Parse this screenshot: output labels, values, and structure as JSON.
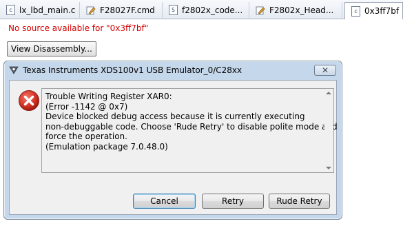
{
  "tabs": [
    {
      "label": "lx_lbd_main.c",
      "icon": "c-file-icon",
      "glyph": "c"
    },
    {
      "label": "F28027F.cmd",
      "icon": "pencil-file-icon"
    },
    {
      "label": "f2802x_code...",
      "icon": "s-file-icon",
      "glyph": "S"
    },
    {
      "label": "F2802x_Head...",
      "icon": "pencil-file-icon"
    },
    {
      "label": "0x3ff7bf",
      "icon": "c-file-icon",
      "glyph": "c",
      "active": true
    }
  ],
  "editor": {
    "no_source": "No source available for \"0x3ff7bf\"",
    "view_disassembly": "View Disassembly..."
  },
  "dialog": {
    "title": "Texas Instruments XDS100v1 USB Emulator_0/C28xx",
    "close_glyph": "✕",
    "message_lines": [
      "Trouble Writing Register XAR0:",
      "(Error -1142 @ 0x7)",
      "Device blocked debug access because it is currently executing",
      "non-debuggable code. Choose 'Rude Retry' to disable polite mode and",
      "force the operation.",
      "(Emulation package 7.0.48.0)"
    ],
    "buttons": {
      "cancel": "Cancel",
      "retry": "Retry",
      "rude_retry": "Rude Retry"
    }
  },
  "colors": {
    "error_red": "#d40000",
    "dialog_frame": "#c5d7ea",
    "error_icon": "#d93a2b"
  }
}
